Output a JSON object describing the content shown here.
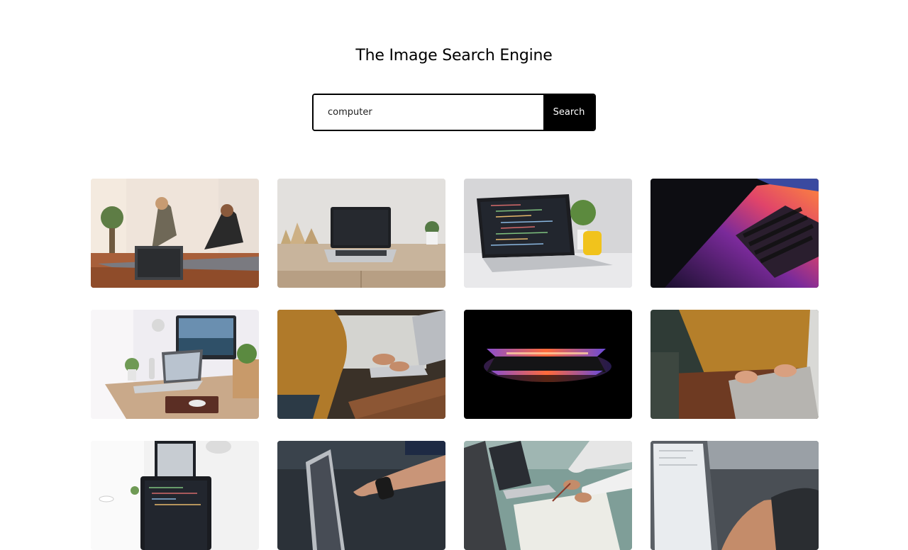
{
  "page": {
    "title": "The Image Search Engine"
  },
  "search": {
    "value": "computer",
    "placeholder": "",
    "button_label": "Search"
  },
  "results": [
    {
      "subject": "two women stretching on yoga mats with a laptop on the floor"
    },
    {
      "subject": "laptop on a wooden desk with decorative houses and a small plant"
    },
    {
      "subject": "laptop showing code beside a plant in a yellow cup"
    },
    {
      "subject": "close-up of a laptop keyboard lit in purple and orange"
    },
    {
      "subject": "desk with a laptop, desktop monitor, lamp and mouse"
    },
    {
      "subject": "person in a mustard sweater typing on a laptop"
    },
    {
      "subject": "partially closed laptop glowing on a black background"
    },
    {
      "subject": "hands on a laptop keyboard, person in a mustard sweater"
    },
    {
      "subject": "desk with laptop showing code and a lamp"
    },
    {
      "subject": "hand pointing at a laptop screen"
    },
    {
      "subject": "people working at a table with laptops and notes"
    },
    {
      "subject": "person typing on a laptop in front of a monitor"
    }
  ]
}
